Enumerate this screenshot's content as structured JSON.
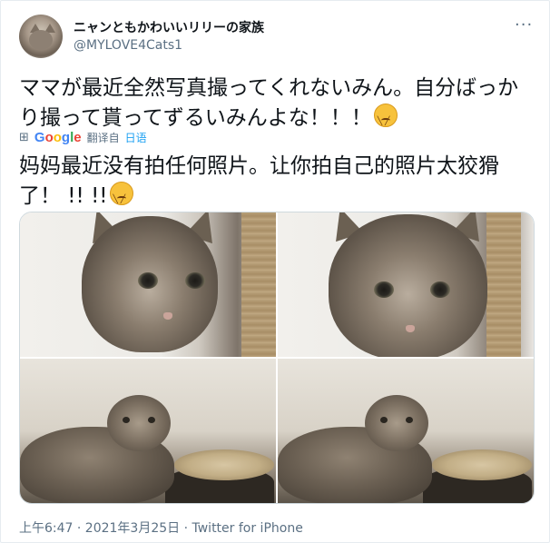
{
  "tweet": {
    "display_name": "ニャンともかわいいリリーの家族",
    "handle": "@MYLOVE4Cats1",
    "more_label": "···",
    "text": "ママが最近全然写真撮ってくれないみん。自分ばっかり撮って貰ってずるいみんよな！！！",
    "emoji_name": "pouting-cat-emoji"
  },
  "translation": {
    "icon": "translate-icon",
    "provider": "Google",
    "translated_by": "翻译自",
    "source_language": "日语",
    "text": "妈妈最近没有拍任何照片。让你拍自己的照片太狡猾了！ !! !!"
  },
  "media": {
    "photos": [
      {
        "name": "cat-closeup-1"
      },
      {
        "name": "cat-closeup-2"
      },
      {
        "name": "cat-standing-1"
      },
      {
        "name": "cat-standing-2"
      }
    ]
  },
  "footer": {
    "timestamp": "上午6:47 · 2021年3月25日 · Twitter for iPhone"
  }
}
